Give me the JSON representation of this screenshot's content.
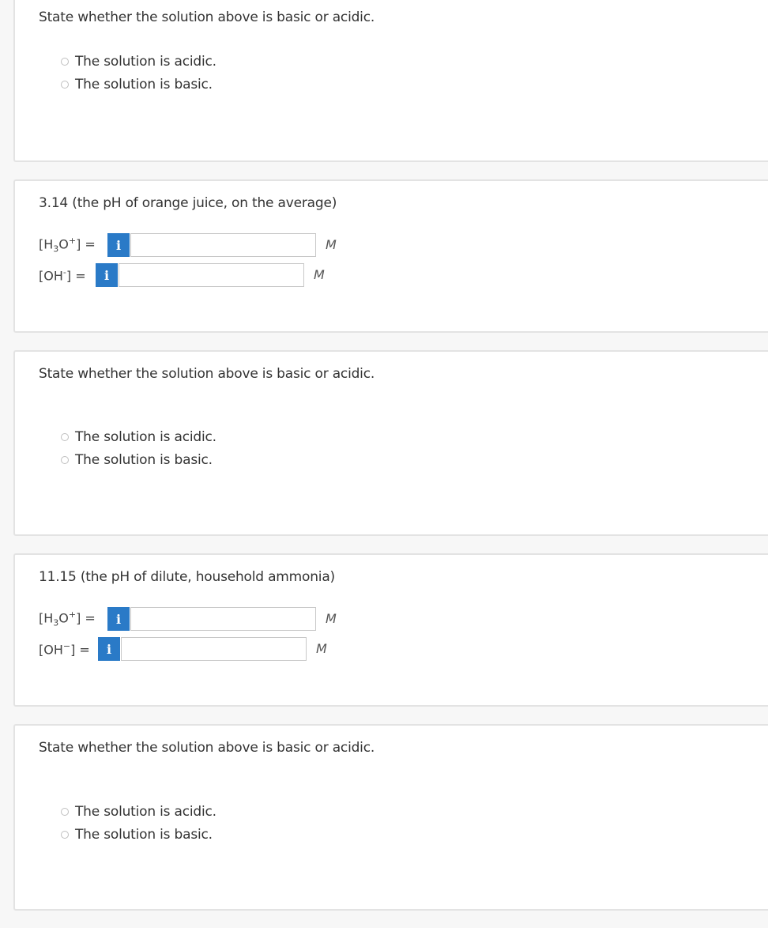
{
  "card1": {
    "prompt": "State whether the solution above is basic or acidic.",
    "options": [
      "The solution is acidic.",
      "The solution is basic."
    ]
  },
  "card2": {
    "prompt": "3.14 (the pH of orange juice, on the average)",
    "h3o_label": "[H3O+] =",
    "oh_label": "[OH-] =",
    "h3o_value": "",
    "oh_value": "",
    "unit": "M",
    "info_glyph": "i"
  },
  "card3": {
    "prompt": "State whether the solution above is basic or acidic.",
    "options": [
      "The solution is acidic.",
      "The solution is basic."
    ]
  },
  "card4": {
    "prompt": "11.15 (the pH of dilute, household ammonia)",
    "h3o_label": "[H3O+] =",
    "oh_label": "[OH−] =",
    "h3o_value": "",
    "oh_value": "",
    "unit": "M",
    "info_glyph": "i"
  },
  "card5": {
    "prompt": "State whether the solution above is basic or acidic.",
    "options": [
      "The solution is acidic.",
      "The solution is basic."
    ]
  },
  "colors": {
    "info_button": "#2a7ac7",
    "card_border": "#e3e3e3",
    "background": "#f7f7f7"
  },
  "icons": {
    "info": "info-icon",
    "radio": "radio-button"
  }
}
